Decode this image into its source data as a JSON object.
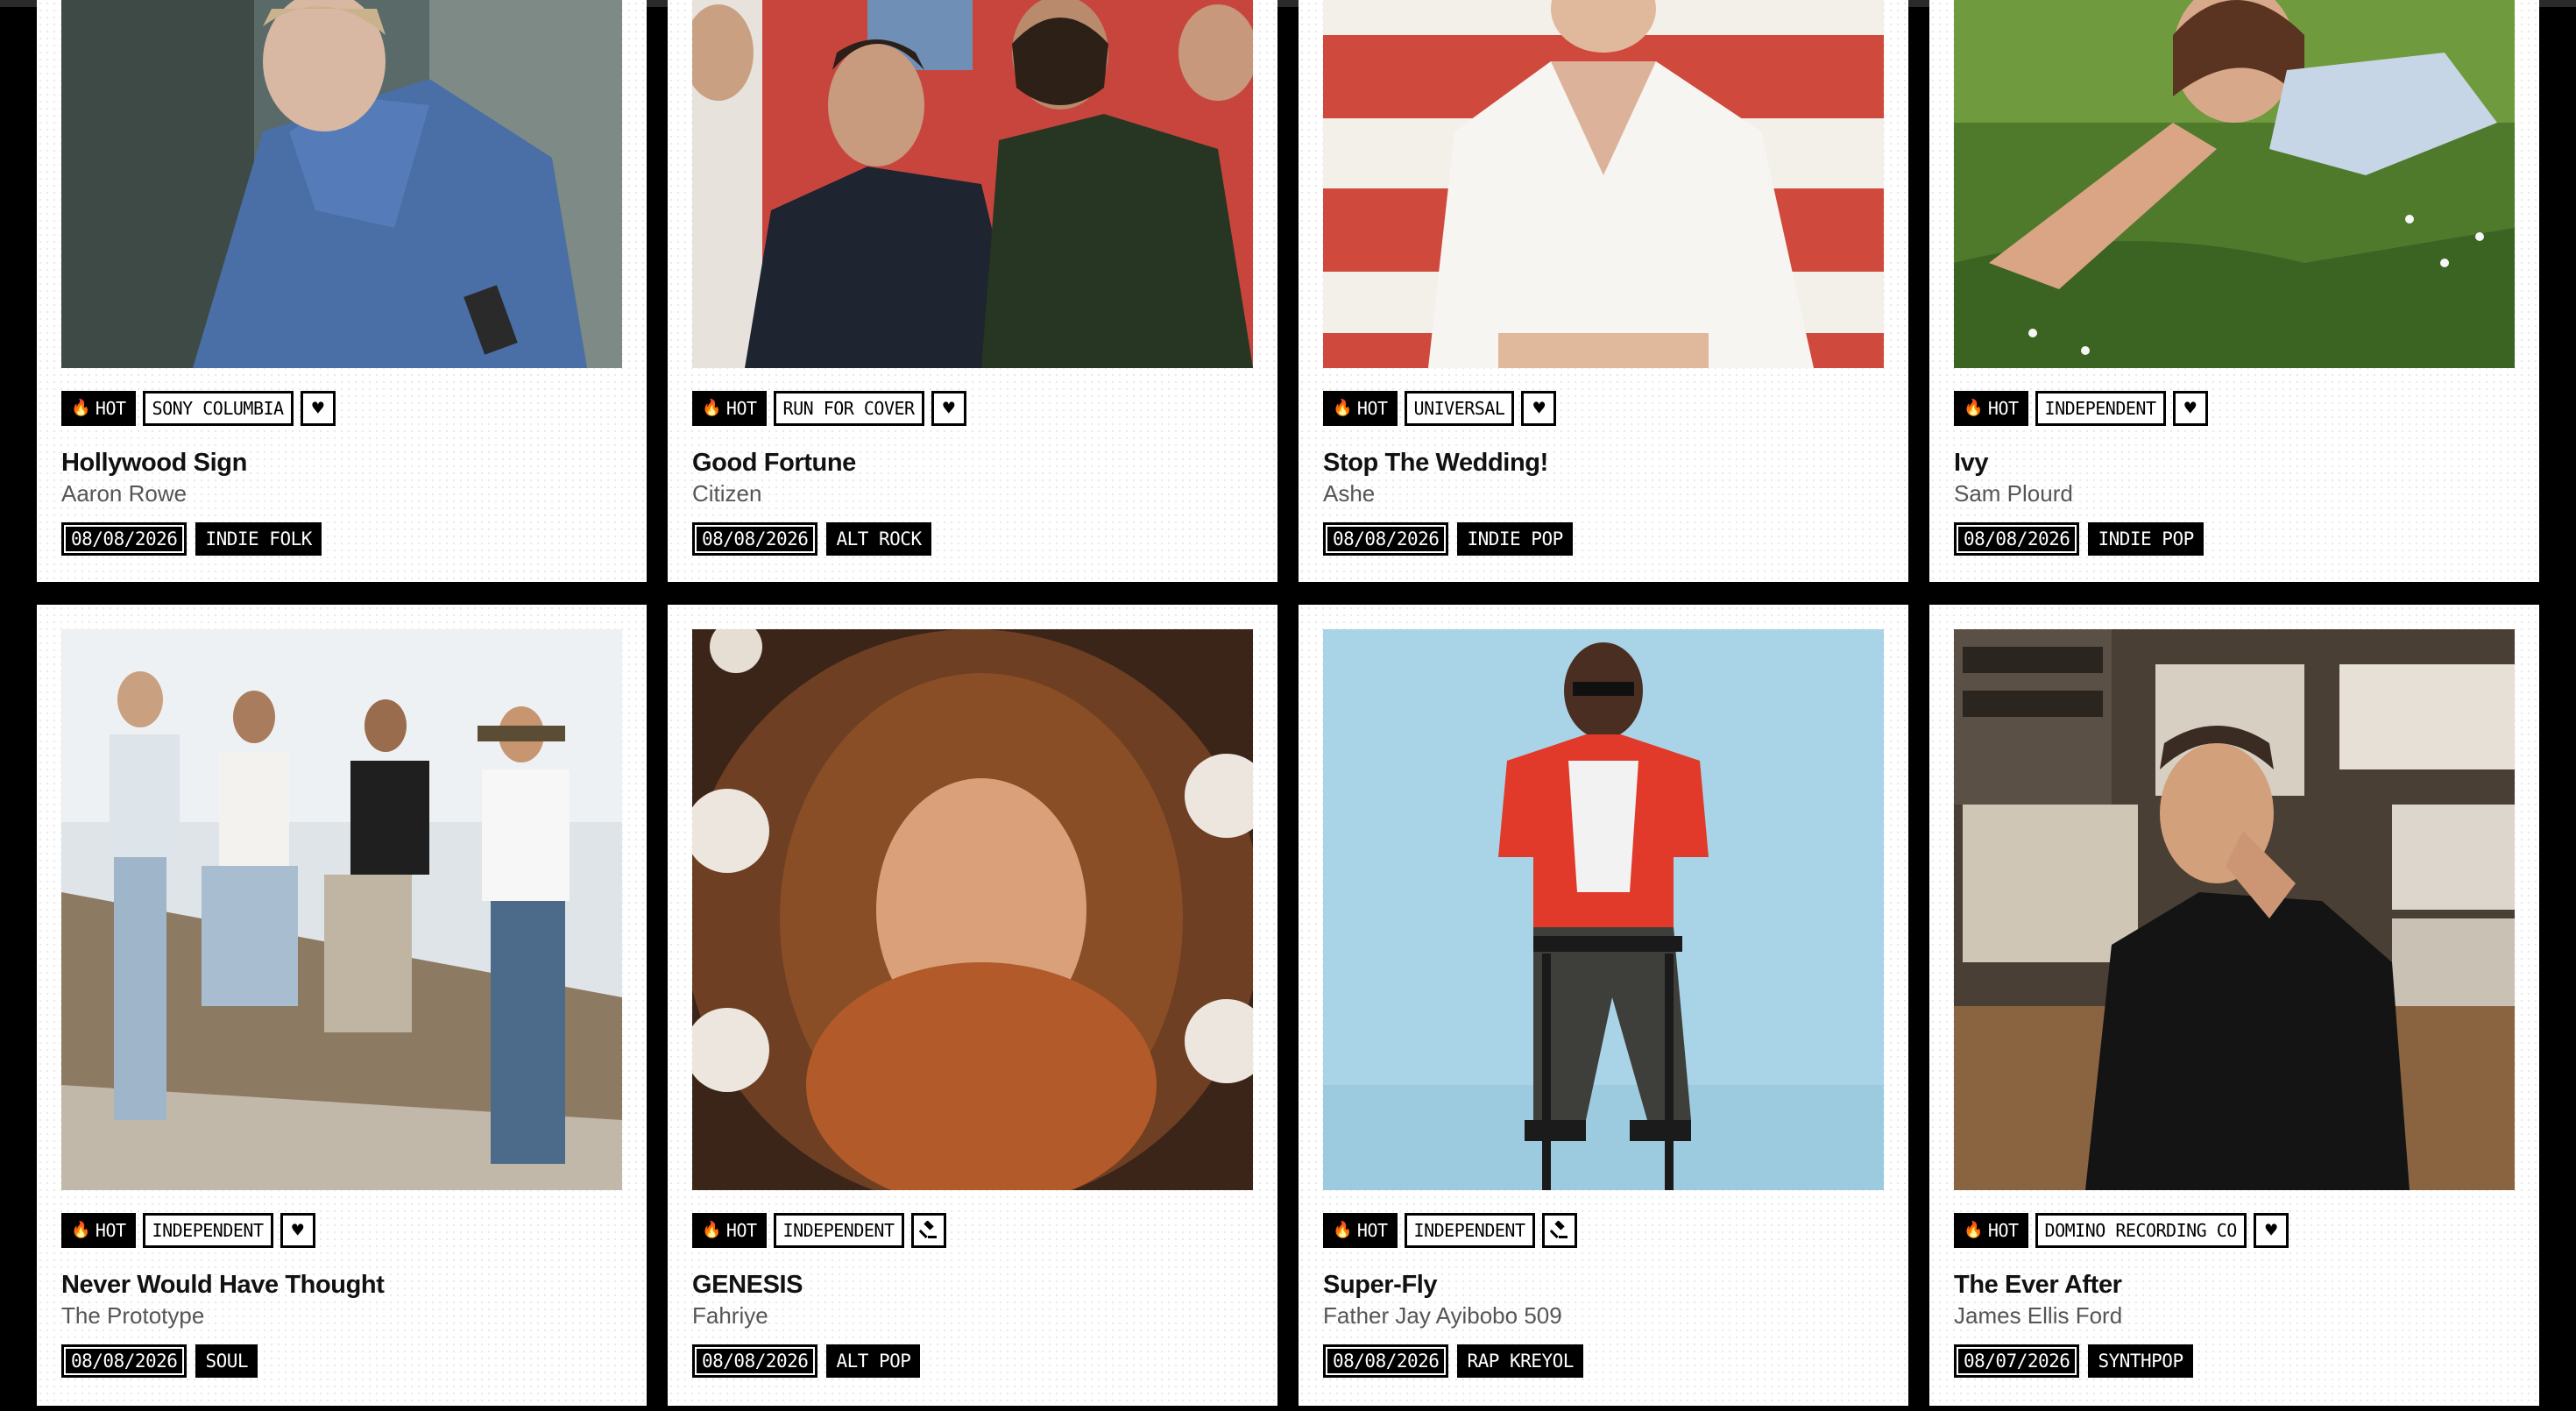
{
  "hot_label": "HOT",
  "cards": [
    {
      "title": "Hollywood Sign",
      "artist": "Aaron Rowe",
      "label": "SONY COLUMBIA",
      "action_icon": "heart-icon",
      "date": "08/08/2026",
      "genre": "INDIE FOLK",
      "image": "man in blue jacket against concrete wall"
    },
    {
      "title": "Good Fortune",
      "artist": "Citizen",
      "label": "RUN FOR COVER",
      "action_icon": "heart-icon",
      "date": "08/08/2026",
      "genre": "ALT ROCK",
      "image": "band seated in front of red backdrop"
    },
    {
      "title": "Stop The Wedding!",
      "artist": "Ashe",
      "label": "UNIVERSAL",
      "action_icon": "heart-icon",
      "date": "08/08/2026",
      "genre": "INDIE POP",
      "image": "woman in white blouse before striped flag"
    },
    {
      "title": "Ivy",
      "artist": "Sam Plourd",
      "label": "INDEPENDENT",
      "action_icon": "heart-icon",
      "date": "08/08/2026",
      "genre": "INDIE POP",
      "image": "woman lying in grass"
    },
    {
      "title": "Never Would Have Thought",
      "artist": "The Prototype",
      "label": "INDEPENDENT",
      "action_icon": "heart-icon",
      "date": "08/08/2026",
      "genre": "SOUL",
      "image": "four men sitting on a log"
    },
    {
      "title": "GENESIS",
      "artist": "Fahriye",
      "label": "INDEPENDENT",
      "action_icon": "gavel-icon",
      "date": "08/08/2026",
      "genre": "ALT POP",
      "image": "curly haired woman with vanity lights"
    },
    {
      "title": "Super-Fly",
      "artist": "Father Jay Ayibobo 509",
      "label": "INDEPENDENT",
      "action_icon": "gavel-icon",
      "date": "08/08/2026",
      "genre": "RAP KREYOL",
      "image": "man in red shirt on stool"
    },
    {
      "title": "The Ever After",
      "artist": "James Ellis Ford",
      "label": "DOMINO RECORDING CO",
      "action_icon": "heart-icon",
      "date": "08/07/2026",
      "genre": "SYNTHPOP",
      "image": "man in studio with modular synths"
    }
  ],
  "colors": {
    "page_bg": "#000000",
    "card_bg": "#ffffff",
    "tag_border": "#000000",
    "artist_text": "#555555"
  }
}
